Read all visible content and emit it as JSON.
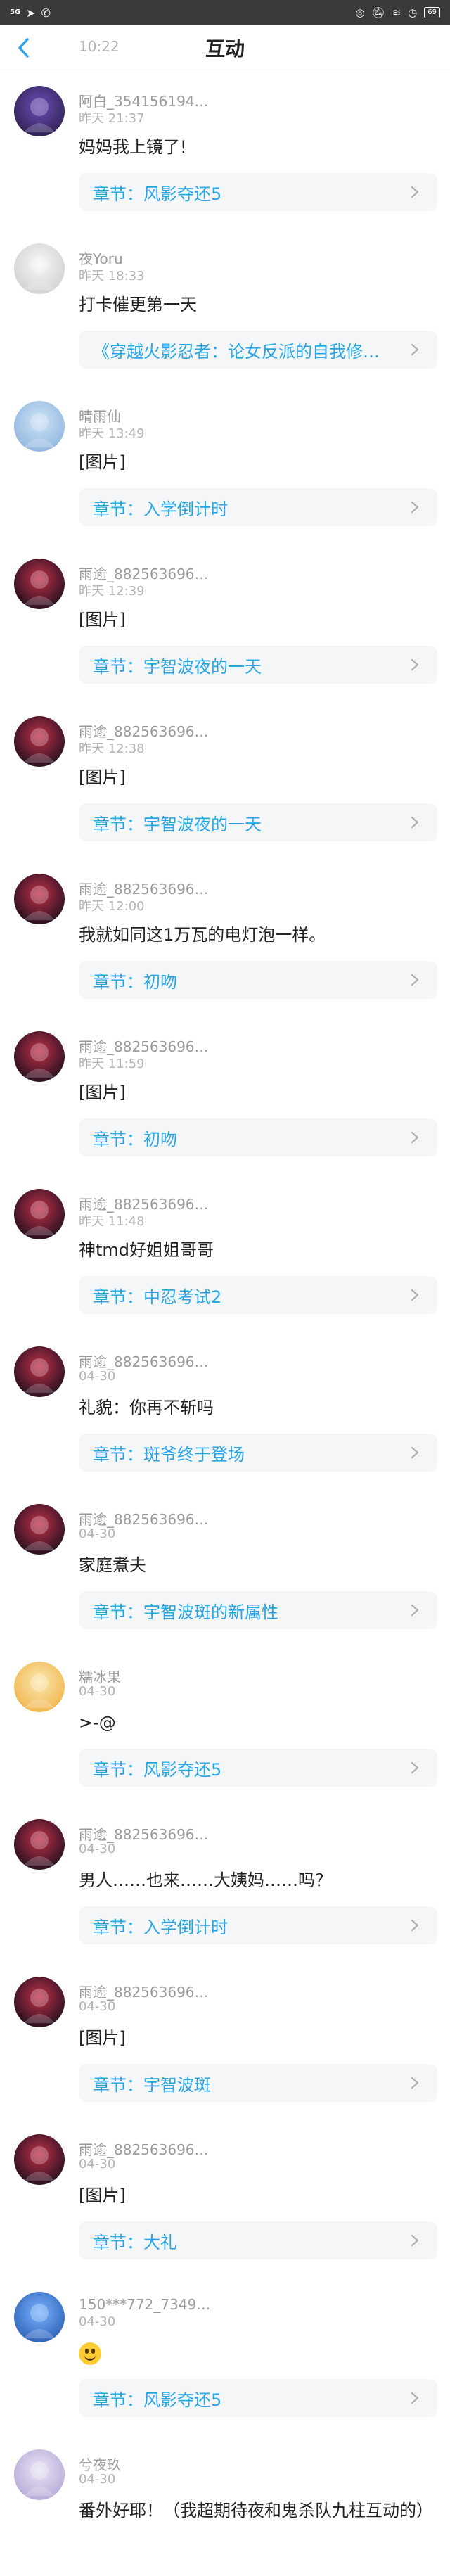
{
  "status": {
    "network": "5G",
    "time": "10:22",
    "battery": "69"
  },
  "header": {
    "title": "互动"
  },
  "items": [
    {
      "name": "阿白_354156194…",
      "time": "昨天 21:37",
      "content": "妈妈我上镜了!",
      "chapter": "章节：风影夺还5"
    },
    {
      "name": "夜Yoru",
      "time": "昨天 18:33",
      "content": "打卡催更第一天",
      "chapter": "《穿越火影忍者：论女反派的自我修养》"
    },
    {
      "name": "晴雨仙",
      "time": "昨天 13:49",
      "content": "[图片]",
      "chapter": "章节：入学倒计时"
    },
    {
      "name": "雨逾_882563696…",
      "time": "昨天 12:39",
      "content": "[图片]",
      "chapter": "章节：宇智波夜的一天"
    },
    {
      "name": "雨逾_882563696…",
      "time": "昨天 12:38",
      "content": "[图片]",
      "chapter": "章节：宇智波夜的一天"
    },
    {
      "name": "雨逾_882563696…",
      "time": "昨天 12:00",
      "content": "我就如同这1万瓦的电灯泡一样。",
      "chapter": "章节：初吻"
    },
    {
      "name": "雨逾_882563696…",
      "time": "昨天 11:59",
      "content": "[图片]",
      "chapter": "章节：初吻"
    },
    {
      "name": "雨逾_882563696…",
      "time": "昨天 11:48",
      "content": "神tmd好姐姐哥哥",
      "chapter": "章节：中忍考试2"
    },
    {
      "name": "雨逾_882563696…",
      "time": "04-30",
      "content": "礼貌：你再不斩吗",
      "chapter": "章节：斑爷终于登场"
    },
    {
      "name": "雨逾_882563696…",
      "time": "04-30",
      "content": "家庭煮夫",
      "chapter": "章节：宇智波斑的新属性"
    },
    {
      "name": "糯冰果",
      "time": "04-30",
      "content": ">-@",
      "chapter": "章节：风影夺还5"
    },
    {
      "name": "雨逾_882563696…",
      "time": "04-30",
      "content": "男人……也来……大姨妈……吗？",
      "chapter": "章节：入学倒计时"
    },
    {
      "name": "雨逾_882563696…",
      "time": "04-30",
      "content": "[图片]",
      "chapter": "章节：宇智波斑"
    },
    {
      "name": "雨逾_882563696…",
      "time": "04-30",
      "content": "[图片]",
      "chapter": "章节：大礼"
    },
    {
      "name": "150***772_7349…",
      "time": "04-30",
      "content": "",
      "chapter": "章节：风影夺还5",
      "emoji": "grinning-face-emoji"
    },
    {
      "name": "兮夜玖",
      "time": "04-30",
      "content": "番外好耶！（我超期待夜和鬼杀队九柱互动的）",
      "chapter": ""
    }
  ]
}
